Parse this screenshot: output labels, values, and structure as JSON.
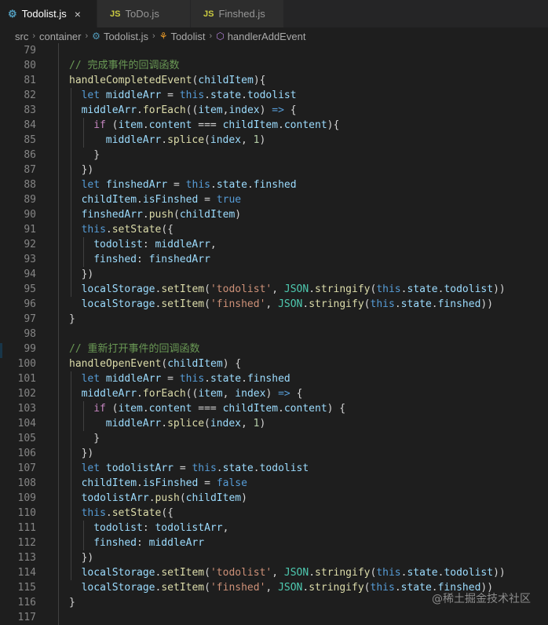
{
  "tabs": [
    {
      "label": "Todolist.js",
      "icon": "gear-icon",
      "active": true
    },
    {
      "label": "ToDo.js",
      "icon": "js-icon",
      "active": false
    },
    {
      "label": "Finshed.js",
      "icon": "js-icon",
      "active": false
    }
  ],
  "icon_glyphs": {
    "js": "JS",
    "close": "×",
    "chevron": "›"
  },
  "breadcrumb": [
    "src",
    "container",
    "Todolist.js",
    "Todolist",
    "handlerAddEvent"
  ],
  "watermark": "@稀土掘金技术社区",
  "colors": {
    "comment": "#6a9955",
    "function": "#dcdcaa",
    "keyword": "#569cd6",
    "control": "#c586c0",
    "variable": "#9cdcfe",
    "string": "#ce9178",
    "number": "#b5cea8",
    "class": "#4ec9b0",
    "punct": "#d4d4d4"
  },
  "code_lines": [
    {
      "n": "79",
      "indent": 0,
      "tokens": []
    },
    {
      "n": "80",
      "indent": 0,
      "tokens": [
        [
          "cm",
          "// 完成事件的回调函数"
        ]
      ]
    },
    {
      "n": "81",
      "indent": 0,
      "tokens": [
        [
          "fn",
          "handleCompletedEvent"
        ],
        [
          "p",
          "("
        ],
        [
          "var",
          "childItem"
        ],
        [
          "p",
          "){"
        ]
      ]
    },
    {
      "n": "82",
      "indent": 1,
      "tokens": [
        [
          "kw",
          "let "
        ],
        [
          "var",
          "middleArr"
        ],
        [
          "p",
          " = "
        ],
        [
          "kw",
          "this"
        ],
        [
          "p",
          "."
        ],
        [
          "var",
          "state"
        ],
        [
          "p",
          "."
        ],
        [
          "var",
          "todolist"
        ]
      ]
    },
    {
      "n": "83",
      "indent": 1,
      "tokens": [
        [
          "var",
          "middleArr"
        ],
        [
          "p",
          "."
        ],
        [
          "fn",
          "forEach"
        ],
        [
          "p",
          "(("
        ],
        [
          "var",
          "item"
        ],
        [
          "p",
          ","
        ],
        [
          "var",
          "index"
        ],
        [
          "p",
          ") "
        ],
        [
          "kw",
          "=>"
        ],
        [
          "p",
          " {"
        ]
      ]
    },
    {
      "n": "84",
      "indent": 2,
      "tokens": [
        [
          "ctl",
          "if"
        ],
        [
          "p",
          " ("
        ],
        [
          "var",
          "item"
        ],
        [
          "p",
          "."
        ],
        [
          "var",
          "content"
        ],
        [
          "p",
          " === "
        ],
        [
          "var",
          "childItem"
        ],
        [
          "p",
          "."
        ],
        [
          "var",
          "content"
        ],
        [
          "p",
          "){"
        ]
      ]
    },
    {
      "n": "85",
      "indent": 3,
      "tokens": [
        [
          "var",
          "middleArr"
        ],
        [
          "p",
          "."
        ],
        [
          "fn",
          "splice"
        ],
        [
          "p",
          "("
        ],
        [
          "var",
          "index"
        ],
        [
          "p",
          ", "
        ],
        [
          "num",
          "1"
        ],
        [
          "p",
          ")"
        ]
      ]
    },
    {
      "n": "86",
      "indent": 2,
      "tokens": [
        [
          "p",
          "}"
        ]
      ]
    },
    {
      "n": "87",
      "indent": 1,
      "tokens": [
        [
          "p",
          "})"
        ]
      ]
    },
    {
      "n": "88",
      "indent": 1,
      "tokens": [
        [
          "kw",
          "let "
        ],
        [
          "var",
          "finshedArr"
        ],
        [
          "p",
          " = "
        ],
        [
          "kw",
          "this"
        ],
        [
          "p",
          "."
        ],
        [
          "var",
          "state"
        ],
        [
          "p",
          "."
        ],
        [
          "var",
          "finshed"
        ]
      ]
    },
    {
      "n": "89",
      "indent": 1,
      "tokens": [
        [
          "var",
          "childItem"
        ],
        [
          "p",
          "."
        ],
        [
          "var",
          "isFinshed"
        ],
        [
          "p",
          " = "
        ],
        [
          "kw",
          "true"
        ]
      ]
    },
    {
      "n": "90",
      "indent": 1,
      "tokens": [
        [
          "var",
          "finshedArr"
        ],
        [
          "p",
          "."
        ],
        [
          "fn",
          "push"
        ],
        [
          "p",
          "("
        ],
        [
          "var",
          "childItem"
        ],
        [
          "p",
          ")"
        ]
      ]
    },
    {
      "n": "91",
      "indent": 1,
      "tokens": [
        [
          "kw",
          "this"
        ],
        [
          "p",
          "."
        ],
        [
          "fn",
          "setState"
        ],
        [
          "p",
          "({"
        ]
      ]
    },
    {
      "n": "92",
      "indent": 2,
      "tokens": [
        [
          "var",
          "todolist"
        ],
        [
          "p",
          ": "
        ],
        [
          "var",
          "middleArr"
        ],
        [
          "p",
          ","
        ]
      ]
    },
    {
      "n": "93",
      "indent": 2,
      "tokens": [
        [
          "var",
          "finshed"
        ],
        [
          "p",
          ": "
        ],
        [
          "var",
          "finshedArr"
        ]
      ]
    },
    {
      "n": "94",
      "indent": 1,
      "tokens": [
        [
          "p",
          "})"
        ]
      ]
    },
    {
      "n": "95",
      "indent": 1,
      "tokens": [
        [
          "var",
          "localStorage"
        ],
        [
          "p",
          "."
        ],
        [
          "fn",
          "setItem"
        ],
        [
          "p",
          "("
        ],
        [
          "str",
          "'todolist'"
        ],
        [
          "p",
          ", "
        ],
        [
          "cls",
          "JSON"
        ],
        [
          "p",
          "."
        ],
        [
          "fn",
          "stringify"
        ],
        [
          "p",
          "("
        ],
        [
          "kw",
          "this"
        ],
        [
          "p",
          "."
        ],
        [
          "var",
          "state"
        ],
        [
          "p",
          "."
        ],
        [
          "var",
          "todolist"
        ],
        [
          "p",
          "))"
        ]
      ]
    },
    {
      "n": "96",
      "indent": 1,
      "tokens": [
        [
          "var",
          "localStorage"
        ],
        [
          "p",
          "."
        ],
        [
          "fn",
          "setItem"
        ],
        [
          "p",
          "("
        ],
        [
          "str",
          "'finshed'"
        ],
        [
          "p",
          ", "
        ],
        [
          "cls",
          "JSON"
        ],
        [
          "p",
          "."
        ],
        [
          "fn",
          "stringify"
        ],
        [
          "p",
          "("
        ],
        [
          "kw",
          "this"
        ],
        [
          "p",
          "."
        ],
        [
          "var",
          "state"
        ],
        [
          "p",
          "."
        ],
        [
          "var",
          "finshed"
        ],
        [
          "p",
          "))"
        ]
      ]
    },
    {
      "n": "97",
      "indent": 0,
      "tokens": [
        [
          "p",
          "}"
        ]
      ]
    },
    {
      "n": "98",
      "indent": 0,
      "tokens": []
    },
    {
      "n": "99",
      "indent": 0,
      "tokens": [
        [
          "cm",
          "// 重新打开事件的回调函数"
        ]
      ]
    },
    {
      "n": "100",
      "indent": 0,
      "tokens": [
        [
          "fn",
          "handleOpenEvent"
        ],
        [
          "p",
          "("
        ],
        [
          "var",
          "childItem"
        ],
        [
          "p",
          ") {"
        ]
      ]
    },
    {
      "n": "101",
      "indent": 1,
      "tokens": [
        [
          "kw",
          "let "
        ],
        [
          "var",
          "middleArr"
        ],
        [
          "p",
          " = "
        ],
        [
          "kw",
          "this"
        ],
        [
          "p",
          "."
        ],
        [
          "var",
          "state"
        ],
        [
          "p",
          "."
        ],
        [
          "var",
          "finshed"
        ]
      ]
    },
    {
      "n": "102",
      "indent": 1,
      "tokens": [
        [
          "var",
          "middleArr"
        ],
        [
          "p",
          "."
        ],
        [
          "fn",
          "forEach"
        ],
        [
          "p",
          "(("
        ],
        [
          "var",
          "item"
        ],
        [
          "p",
          ", "
        ],
        [
          "var",
          "index"
        ],
        [
          "p",
          ") "
        ],
        [
          "kw",
          "=>"
        ],
        [
          "p",
          " {"
        ]
      ]
    },
    {
      "n": "103",
      "indent": 2,
      "tokens": [
        [
          "ctl",
          "if"
        ],
        [
          "p",
          " ("
        ],
        [
          "var",
          "item"
        ],
        [
          "p",
          "."
        ],
        [
          "var",
          "content"
        ],
        [
          "p",
          " === "
        ],
        [
          "var",
          "childItem"
        ],
        [
          "p",
          "."
        ],
        [
          "var",
          "content"
        ],
        [
          "p",
          ") {"
        ]
      ]
    },
    {
      "n": "104",
      "indent": 3,
      "tokens": [
        [
          "var",
          "middleArr"
        ],
        [
          "p",
          "."
        ],
        [
          "fn",
          "splice"
        ],
        [
          "p",
          "("
        ],
        [
          "var",
          "index"
        ],
        [
          "p",
          ", "
        ],
        [
          "num",
          "1"
        ],
        [
          "p",
          ")"
        ]
      ]
    },
    {
      "n": "105",
      "indent": 2,
      "tokens": [
        [
          "p",
          "}"
        ]
      ]
    },
    {
      "n": "106",
      "indent": 1,
      "tokens": [
        [
          "p",
          "})"
        ]
      ]
    },
    {
      "n": "107",
      "indent": 1,
      "tokens": [
        [
          "kw",
          "let "
        ],
        [
          "var",
          "todolistArr"
        ],
        [
          "p",
          " = "
        ],
        [
          "kw",
          "this"
        ],
        [
          "p",
          "."
        ],
        [
          "var",
          "state"
        ],
        [
          "p",
          "."
        ],
        [
          "var",
          "todolist"
        ]
      ]
    },
    {
      "n": "108",
      "indent": 1,
      "tokens": [
        [
          "var",
          "childItem"
        ],
        [
          "p",
          "."
        ],
        [
          "var",
          "isFinshed"
        ],
        [
          "p",
          " = "
        ],
        [
          "kw",
          "false"
        ]
      ]
    },
    {
      "n": "109",
      "indent": 1,
      "tokens": [
        [
          "var",
          "todolistArr"
        ],
        [
          "p",
          "."
        ],
        [
          "fn",
          "push"
        ],
        [
          "p",
          "("
        ],
        [
          "var",
          "childItem"
        ],
        [
          "p",
          ")"
        ]
      ]
    },
    {
      "n": "110",
      "indent": 1,
      "tokens": [
        [
          "kw",
          "this"
        ],
        [
          "p",
          "."
        ],
        [
          "fn",
          "setState"
        ],
        [
          "p",
          "({"
        ]
      ]
    },
    {
      "n": "111",
      "indent": 2,
      "tokens": [
        [
          "var",
          "todolist"
        ],
        [
          "p",
          ": "
        ],
        [
          "var",
          "todolistArr"
        ],
        [
          "p",
          ","
        ]
      ]
    },
    {
      "n": "112",
      "indent": 2,
      "tokens": [
        [
          "var",
          "finshed"
        ],
        [
          "p",
          ": "
        ],
        [
          "var",
          "middleArr"
        ]
      ]
    },
    {
      "n": "113",
      "indent": 1,
      "tokens": [
        [
          "p",
          "})"
        ]
      ]
    },
    {
      "n": "114",
      "indent": 1,
      "tokens": [
        [
          "var",
          "localStorage"
        ],
        [
          "p",
          "."
        ],
        [
          "fn",
          "setItem"
        ],
        [
          "p",
          "("
        ],
        [
          "str",
          "'todolist'"
        ],
        [
          "p",
          ", "
        ],
        [
          "cls",
          "JSON"
        ],
        [
          "p",
          "."
        ],
        [
          "fn",
          "stringify"
        ],
        [
          "p",
          "("
        ],
        [
          "kw",
          "this"
        ],
        [
          "p",
          "."
        ],
        [
          "var",
          "state"
        ],
        [
          "p",
          "."
        ],
        [
          "var",
          "todolist"
        ],
        [
          "p",
          "))"
        ]
      ]
    },
    {
      "n": "115",
      "indent": 1,
      "tokens": [
        [
          "var",
          "localStorage"
        ],
        [
          "p",
          "."
        ],
        [
          "fn",
          "setItem"
        ],
        [
          "p",
          "("
        ],
        [
          "str",
          "'finshed'"
        ],
        [
          "p",
          ", "
        ],
        [
          "cls",
          "JSON"
        ],
        [
          "p",
          "."
        ],
        [
          "fn",
          "stringify"
        ],
        [
          "p",
          "("
        ],
        [
          "kw",
          "this"
        ],
        [
          "p",
          "."
        ],
        [
          "var",
          "state"
        ],
        [
          "p",
          "."
        ],
        [
          "var",
          "finshed"
        ],
        [
          "p",
          "))"
        ]
      ]
    },
    {
      "n": "116",
      "indent": 0,
      "tokens": [
        [
          "p",
          "}"
        ]
      ]
    },
    {
      "n": "117",
      "indent": 0,
      "tokens": []
    }
  ]
}
